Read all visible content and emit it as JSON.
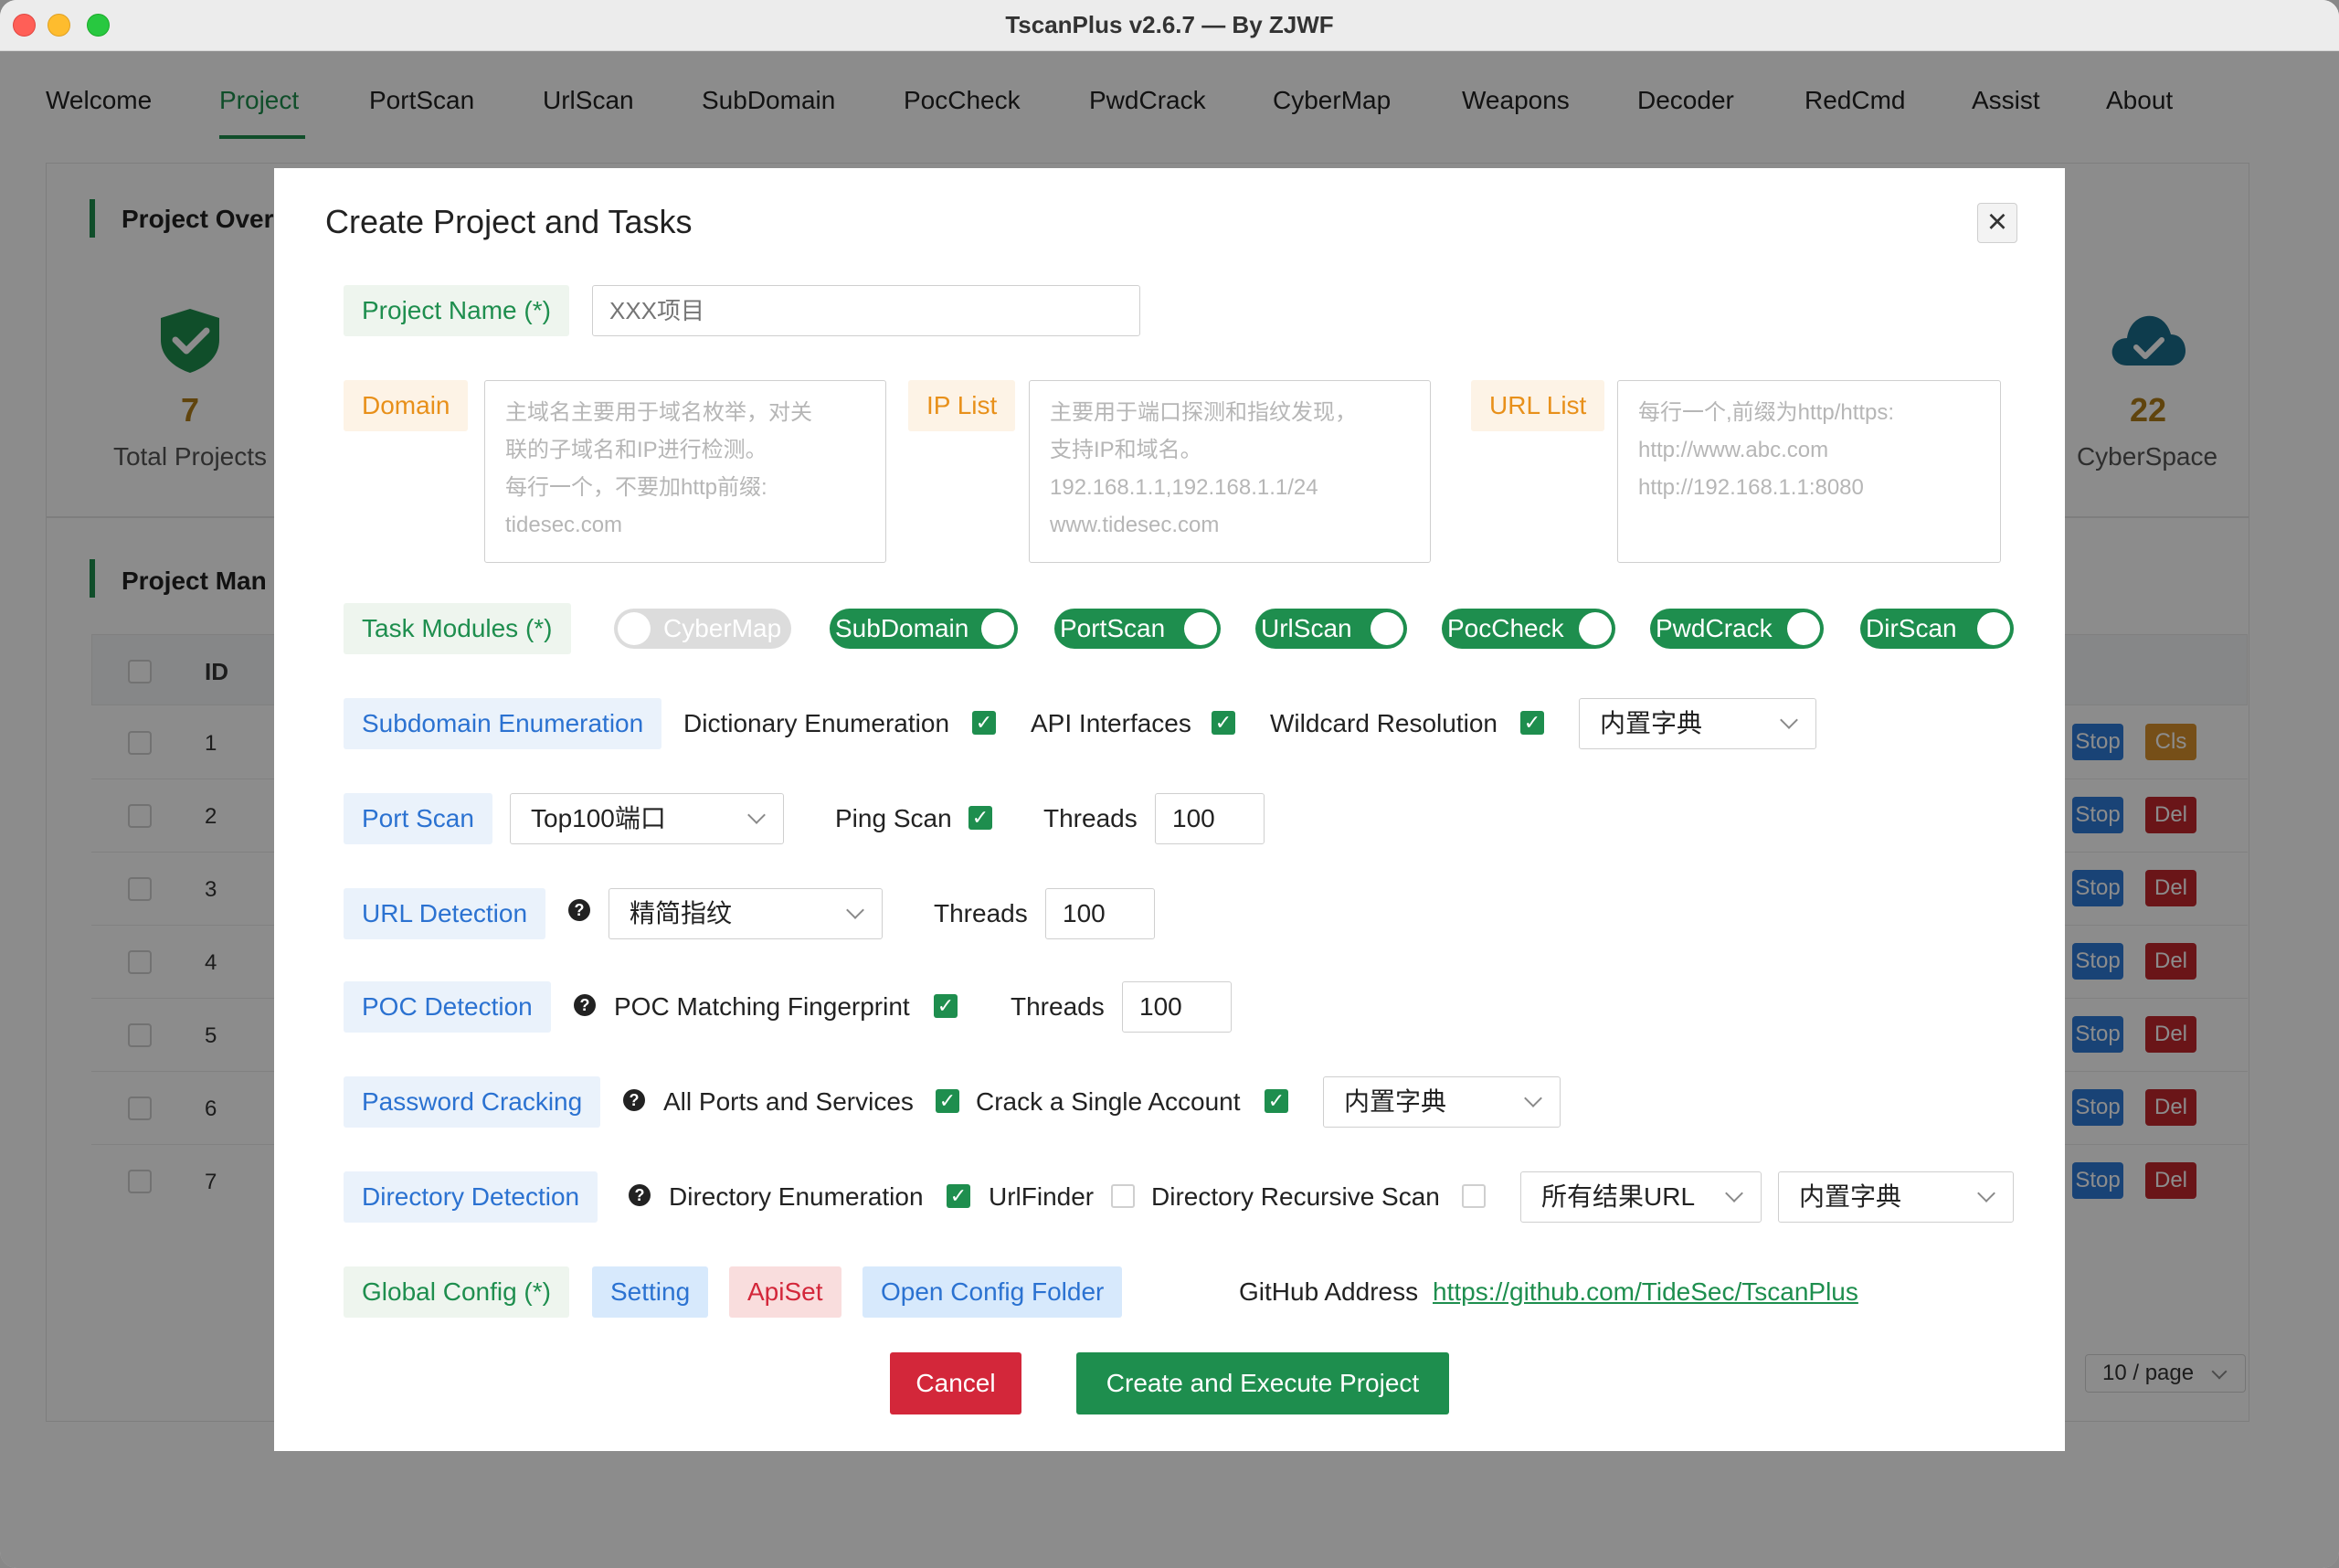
{
  "window": {
    "title": "TscanPlus v2.6.7 — By ZJWF"
  },
  "tabs": [
    "Welcome",
    "Project",
    "PortScan",
    "UrlScan",
    "SubDomain",
    "PocCheck",
    "PwdCrack",
    "CyberMap",
    "Weapons",
    "Decoder",
    "RedCmd",
    "Assist",
    "About"
  ],
  "overview": {
    "title": "Project Over",
    "total_projects": {
      "value": "7",
      "label": "Total Projects"
    },
    "cyberspace": {
      "value": "22",
      "label": "CyberSpace"
    }
  },
  "management": {
    "title": "Project Man",
    "id_header": "ID",
    "rows": [
      {
        "id": "1",
        "a": "Stop",
        "b": "Cls"
      },
      {
        "id": "2",
        "a": "Stop",
        "b": "Del"
      },
      {
        "id": "3",
        "a": "Stop",
        "b": "Del"
      },
      {
        "id": "4",
        "a": "Stop",
        "b": "Del"
      },
      {
        "id": "5",
        "a": "Stop",
        "b": "Del"
      },
      {
        "id": "6",
        "a": "Stop",
        "b": "Del"
      },
      {
        "id": "7",
        "a": "Stop",
        "b": "Del"
      }
    ],
    "pager": "10 / page"
  },
  "modal": {
    "title": "Create Project and Tasks",
    "project_name": {
      "label": "Project Name (*)",
      "placeholder": "XXX项目",
      "value": ""
    },
    "domain": {
      "label": "Domain",
      "placeholder": "主域名主要用于域名枚举，对关\n联的子域名和IP进行检测。\n每行一个，不要加http前缀:\ntidesec.com"
    },
    "ip_list": {
      "label": "IP List",
      "placeholder": "主要用于端口探测和指纹发现，\n支持IP和域名。\n192.168.1.1,192.168.1.1/24\nwww.tidesec.com"
    },
    "url_list": {
      "label": "URL List",
      "placeholder": "每行一个,前缀为http/https:\nhttp://www.abc.com\nhttp://192.168.1.1:8080"
    },
    "task_modules": {
      "label": "Task Modules (*)",
      "items": [
        {
          "name": "CyberMap",
          "on": false
        },
        {
          "name": "SubDomain",
          "on": true
        },
        {
          "name": "PortScan",
          "on": true
        },
        {
          "name": "UrlScan",
          "on": true
        },
        {
          "name": "PocCheck",
          "on": true
        },
        {
          "name": "PwdCrack",
          "on": true
        },
        {
          "name": "DirScan",
          "on": true
        }
      ]
    },
    "subdomain": {
      "label": "Subdomain Enumeration",
      "dict_enum": {
        "label": "Dictionary Enumeration",
        "checked": true
      },
      "api": {
        "label": "API Interfaces",
        "checked": true
      },
      "wildcard": {
        "label": "Wildcard Resolution",
        "checked": true
      },
      "dict_select": "内置字典"
    },
    "portscan": {
      "label": "Port Scan",
      "ports_select": "Top100端口",
      "ping": {
        "label": "Ping Scan",
        "checked": true
      },
      "threads_label": "Threads",
      "threads": "100"
    },
    "urldetect": {
      "label": "URL Detection",
      "fingerprint_select": "精简指纹",
      "threads_label": "Threads",
      "threads": "100"
    },
    "pocdetect": {
      "label": "POC Detection",
      "matching": {
        "label": "POC Matching Fingerprint",
        "checked": true
      },
      "threads_label": "Threads",
      "threads": "100"
    },
    "pwdcrack": {
      "label": "Password Cracking",
      "all_ports": {
        "label": "All Ports and Services",
        "checked": true
      },
      "single": {
        "label": "Crack a Single Account",
        "checked": true
      },
      "dict_select": "内置字典"
    },
    "dirdetect": {
      "label": "Directory Detection",
      "enum": {
        "label": "Directory Enumeration",
        "checked": true
      },
      "urlfinder": {
        "label": "UrlFinder",
        "checked": false
      },
      "recursive": {
        "label": "Directory Recursive Scan",
        "checked": false
      },
      "scope_select": "所有结果URL",
      "dict_select": "内置字典"
    },
    "global": {
      "label": "Global Config (*)",
      "setting": "Setting",
      "apiset": "ApiSet",
      "open_folder": "Open Config Folder",
      "github_label": "GitHub Address",
      "github_url": "https://github.com/TideSec/TscanPlus"
    },
    "cancel": "Cancel",
    "create": "Create and Execute Project"
  },
  "colors": {
    "accent": "#1e8e4e",
    "danger": "#d3273a",
    "orange": "#e8901a",
    "blue": "#2b72d1"
  }
}
